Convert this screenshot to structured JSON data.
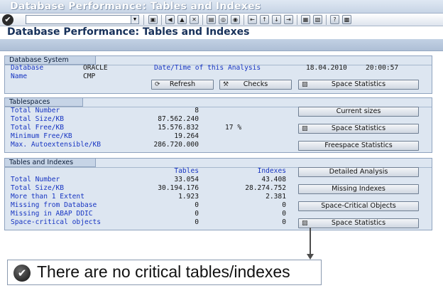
{
  "window": {
    "title": "Database Performance: Tables and Indexes"
  },
  "screen_title": "Database Performance: Tables and Indexes",
  "toolbar": {
    "ok_icon": "check-icon",
    "command_field_value": "",
    "icons": [
      "save-icon",
      "back-icon",
      "exit-icon",
      "cancel-icon",
      "print-icon",
      "find-icon",
      "find-next-icon",
      "first-page-icon",
      "previous-page-icon",
      "next-page-icon",
      "last-page-icon",
      "create-session-icon",
      "shortcut-icon",
      "help-icon",
      "layout-icon"
    ]
  },
  "database_system": {
    "header": "Database System",
    "database_label": "Database",
    "database_value": "ORACLE",
    "name_label": "Name",
    "name_value": "CMP",
    "analysis_label": "Date/Time of this Analysis",
    "analysis_date": "18.04.2010",
    "analysis_time": "20:00:57",
    "refresh_button": "Refresh",
    "checks_button": "Checks",
    "space_statistics_button": "Space Statistics"
  },
  "tablespaces": {
    "header": "Tablespaces",
    "rows": [
      {
        "label": "Total Number",
        "value": "8",
        "extra": ""
      },
      {
        "label": "Total Size/KB",
        "value": "87.562.240",
        "extra": ""
      },
      {
        "label": "Total Free/KB",
        "value": "15.576.832",
        "extra": "17 %"
      },
      {
        "label": "Minimum Free/KB",
        "value": "19.264",
        "extra": ""
      },
      {
        "label": "Max. Autoextensible/KB",
        "value": "286.720.000",
        "extra": ""
      }
    ],
    "current_sizes_button": "Current sizes",
    "space_statistics_button": "Space Statistics",
    "freespace_statistics_button": "Freespace Statistics"
  },
  "tables_indexes": {
    "header": "Tables and Indexes",
    "col_tables": "Tables",
    "col_indexes": "Indexes",
    "rows": [
      {
        "label": "Total Number",
        "tables": "33.054",
        "indexes": "43.408"
      },
      {
        "label": "Total Size/KB",
        "tables": "30.194.176",
        "indexes": "28.274.752"
      },
      {
        "label": "More than 1 Extent",
        "tables": "1.923",
        "indexes": "2.381"
      },
      {
        "label": "Missing from Database",
        "tables": "0",
        "indexes": "0"
      },
      {
        "label": "Missing in ABAP DDIC",
        "tables": "0",
        "indexes": "0"
      },
      {
        "label": "Space-critical objects",
        "tables": "0",
        "indexes": "0"
      }
    ],
    "detailed_analysis_button": "Detailed Analysis",
    "missing_indexes_button": "Missing Indexes",
    "space_critical_button": "Space-Critical Objects",
    "space_statistics_button": "Space Statistics"
  },
  "message": {
    "icon": "check-circle-icon",
    "text": "There are no critical tables/indexes"
  }
}
